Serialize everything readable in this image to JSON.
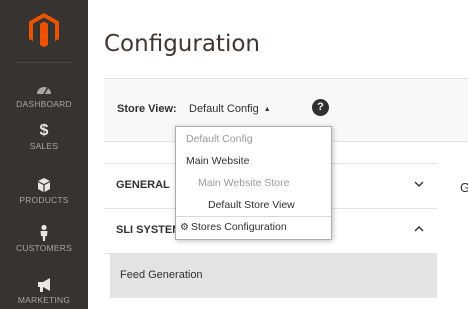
{
  "sidebar": {
    "items": [
      {
        "label": "DASHBOARD",
        "icon": "dashboard-icon"
      },
      {
        "label": "SALES",
        "icon": "dollar-icon",
        "glyph": "$"
      },
      {
        "label": "PRODUCTS",
        "icon": "products-box-icon"
      },
      {
        "label": "CUSTOMERS",
        "icon": "customers-person-icon"
      },
      {
        "label": "MARKETING",
        "icon": "marketing-megaphone-icon"
      }
    ]
  },
  "page": {
    "title": "Configuration"
  },
  "store_view": {
    "label": "Store View:",
    "selected": "Default Config",
    "help_glyph": "?",
    "options": [
      {
        "label": "Default Config",
        "state": "muted"
      },
      {
        "label": "Main Website",
        "state": "normal"
      },
      {
        "label": "Main Website Store",
        "state": "muted"
      },
      {
        "label": "Default Store View",
        "state": "normal"
      },
      {
        "label": "Stores Configuration",
        "state": "normal"
      }
    ]
  },
  "config_tabs": [
    {
      "title": "GENERAL"
    },
    {
      "title": "SLI SYSTEMS"
    }
  ],
  "sub_items": [
    {
      "label": "Feed Generation"
    }
  ],
  "peek": {
    "text": "G"
  },
  "colors": {
    "sidebar_bg": "#373330",
    "brand_orange": "#eb5202"
  }
}
